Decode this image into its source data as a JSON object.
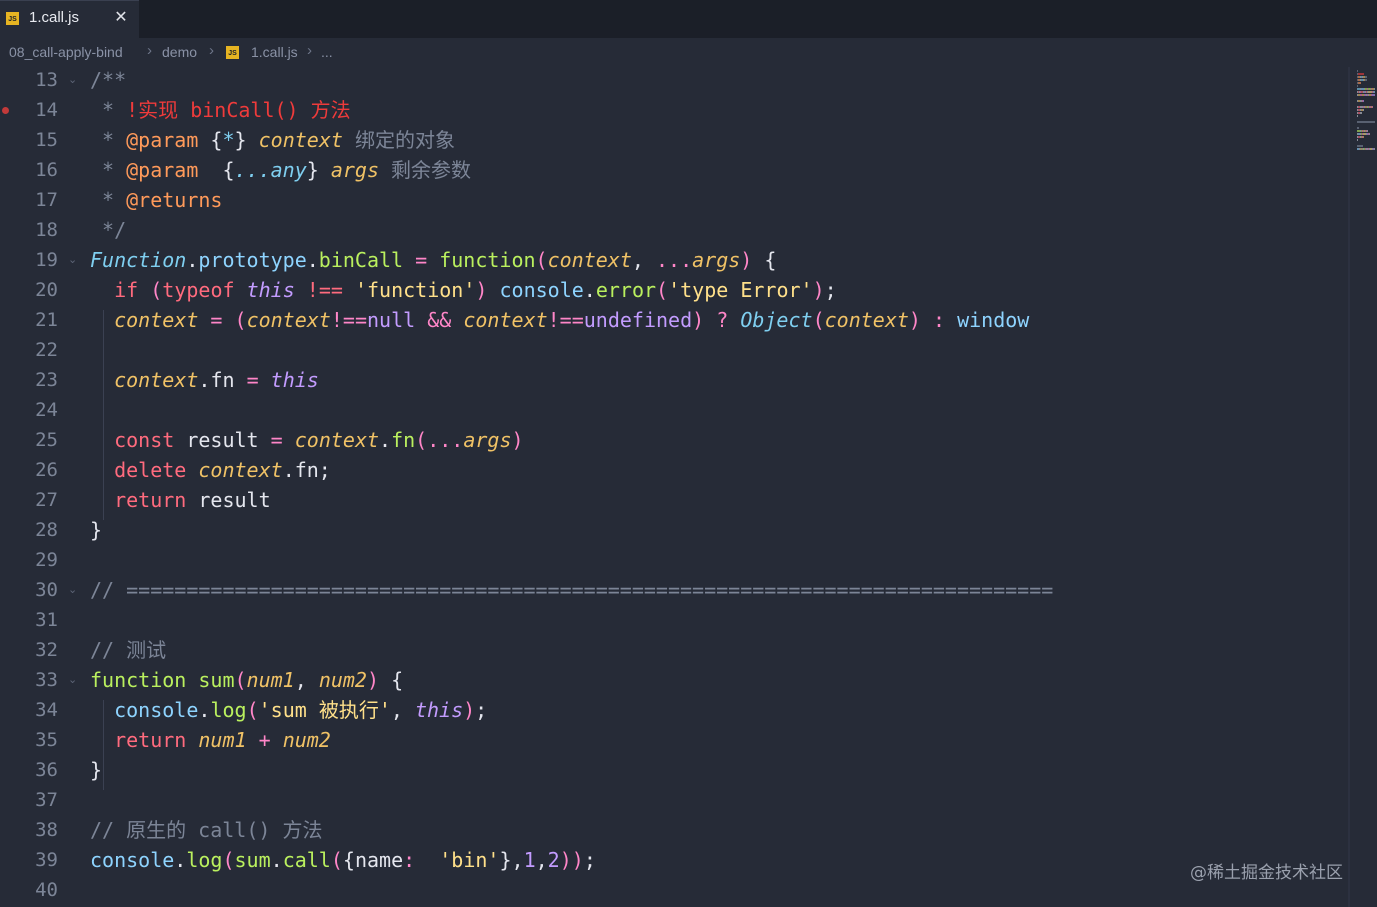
{
  "tab": {
    "icon": "js-file-icon",
    "badge": "JS",
    "title": "1.call.js",
    "close": "✕"
  },
  "breadcrumb": {
    "items": [
      "08_call-apply-bind",
      "demo",
      "1.call.js",
      "..."
    ],
    "separator": "›"
  },
  "editor": {
    "line_numbers": [
      "13",
      "14",
      "15",
      "16",
      "17",
      "18",
      "19",
      "20",
      "21",
      "22",
      "23",
      "24",
      "25",
      "26",
      "27",
      "28",
      "29",
      "30",
      "31",
      "32",
      "33",
      "34",
      "35",
      "36",
      "37",
      "38",
      "39",
      "40"
    ],
    "lines": [
      [
        [
          "cm",
          "/**"
        ]
      ],
      [
        [
          "cm",
          " * "
        ],
        [
          "red",
          "!实现 binCall() 方法"
        ]
      ],
      [
        [
          "cm",
          " * "
        ],
        [
          "tag",
          "@param"
        ],
        [
          "plain",
          " {"
        ],
        [
          "cls",
          "*"
        ],
        [
          "plain",
          "} "
        ],
        [
          "it",
          "context"
        ],
        [
          "cm",
          " 绑定的对象"
        ]
      ],
      [
        [
          "cm",
          " * "
        ],
        [
          "tag",
          "@param"
        ],
        [
          "plain",
          "  {"
        ],
        [
          "cls",
          "...any"
        ],
        [
          "plain",
          "} "
        ],
        [
          "it",
          "args"
        ],
        [
          "cm",
          " 剩余参数"
        ]
      ],
      [
        [
          "cm",
          " * "
        ],
        [
          "tag",
          "@returns"
        ]
      ],
      [
        [
          "cm",
          " */"
        ]
      ],
      [
        [
          "tealit",
          "Function"
        ],
        [
          "plain",
          "."
        ],
        [
          "prop",
          "prototype"
        ],
        [
          "plain",
          "."
        ],
        [
          "fn",
          "binCall"
        ],
        [
          "pink",
          " = "
        ],
        [
          "fn",
          "function"
        ],
        [
          "pl",
          "("
        ],
        [
          "it",
          "context"
        ],
        [
          "plain",
          ", "
        ],
        [
          "pink",
          "..."
        ],
        [
          "it",
          "args"
        ],
        [
          "pl",
          ")"
        ],
        [
          "plain",
          " {"
        ]
      ],
      [
        [
          "plain",
          "  "
        ],
        [
          "kw",
          "if"
        ],
        [
          "plain",
          " "
        ],
        [
          "pl",
          "("
        ],
        [
          "kw",
          "typeof"
        ],
        [
          "plain",
          " "
        ],
        [
          "purit",
          "this"
        ],
        [
          "plain",
          " "
        ],
        [
          "kw",
          "!=="
        ],
        [
          "plain",
          " "
        ],
        [
          "str",
          "'function'"
        ],
        [
          "pl",
          ")"
        ],
        [
          "plain",
          " "
        ],
        [
          "prop",
          "console"
        ],
        [
          "plain",
          "."
        ],
        [
          "fn",
          "error"
        ],
        [
          "pl",
          "("
        ],
        [
          "str",
          "'type Error'"
        ],
        [
          "pl",
          ")"
        ],
        [
          "plain",
          ";"
        ]
      ],
      [
        [
          "plain",
          "  "
        ],
        [
          "it",
          "context"
        ],
        [
          "pink",
          " = "
        ],
        [
          "pl",
          "("
        ],
        [
          "it",
          "context"
        ],
        [
          "pink",
          "!=="
        ],
        [
          "pur",
          "null"
        ],
        [
          "plain",
          " "
        ],
        [
          "pink",
          "&&"
        ],
        [
          "plain",
          " "
        ],
        [
          "it",
          "context"
        ],
        [
          "pink",
          "!=="
        ],
        [
          "pur",
          "undefined"
        ],
        [
          "pl",
          ")"
        ],
        [
          "pink",
          " ? "
        ],
        [
          "tealit",
          "Object"
        ],
        [
          "pl",
          "("
        ],
        [
          "it",
          "context"
        ],
        [
          "pl",
          ")"
        ],
        [
          "pink",
          " : "
        ],
        [
          "prop",
          "window"
        ]
      ],
      [],
      [
        [
          "plain",
          "  "
        ],
        [
          "it",
          "context"
        ],
        [
          "plain",
          "."
        ],
        [
          "plain",
          "fn"
        ],
        [
          "pink",
          " = "
        ],
        [
          "purit",
          "this"
        ]
      ],
      [],
      [
        [
          "plain",
          "  "
        ],
        [
          "kw",
          "const"
        ],
        [
          "plain",
          " result "
        ],
        [
          "pink",
          "="
        ],
        [
          "plain",
          " "
        ],
        [
          "it",
          "context"
        ],
        [
          "plain",
          "."
        ],
        [
          "fn",
          "fn"
        ],
        [
          "pl",
          "("
        ],
        [
          "pink",
          "..."
        ],
        [
          "it",
          "args"
        ],
        [
          "pl",
          ")"
        ]
      ],
      [
        [
          "plain",
          "  "
        ],
        [
          "kw",
          "delete"
        ],
        [
          "plain",
          " "
        ],
        [
          "it",
          "context"
        ],
        [
          "plain",
          ".fn;"
        ]
      ],
      [
        [
          "plain",
          "  "
        ],
        [
          "kw",
          "return"
        ],
        [
          "plain",
          " result"
        ]
      ],
      [
        [
          "plain",
          "}"
        ]
      ],
      [],
      [
        [
          "cm",
          "// ============================================================================="
        ]
      ],
      [],
      [
        [
          "cm",
          "// 测试"
        ]
      ],
      [
        [
          "fn",
          "function"
        ],
        [
          "plain",
          " "
        ],
        [
          "fn",
          "sum"
        ],
        [
          "pl",
          "("
        ],
        [
          "it",
          "num1"
        ],
        [
          "plain",
          ", "
        ],
        [
          "it",
          "num2"
        ],
        [
          "pl",
          ")"
        ],
        [
          "plain",
          " {"
        ]
      ],
      [
        [
          "plain",
          "  "
        ],
        [
          "prop",
          "console"
        ],
        [
          "plain",
          "."
        ],
        [
          "fn",
          "log"
        ],
        [
          "pl",
          "("
        ],
        [
          "str",
          "'sum 被执行'"
        ],
        [
          "plain",
          ", "
        ],
        [
          "purit",
          "this"
        ],
        [
          "pl",
          ")"
        ],
        [
          "plain",
          ";"
        ]
      ],
      [
        [
          "plain",
          "  "
        ],
        [
          "kw",
          "return"
        ],
        [
          "plain",
          " "
        ],
        [
          "it",
          "num1"
        ],
        [
          "pink",
          " + "
        ],
        [
          "it",
          "num2"
        ]
      ],
      [
        [
          "plain",
          "}"
        ]
      ],
      [],
      [
        [
          "cm",
          "// 原生的 call() 方法"
        ]
      ],
      [
        [
          "prop",
          "console"
        ],
        [
          "plain",
          "."
        ],
        [
          "fn",
          "log"
        ],
        [
          "pl",
          "("
        ],
        [
          "fn",
          "sum"
        ],
        [
          "plain",
          "."
        ],
        [
          "fn",
          "call"
        ],
        [
          "pl",
          "("
        ],
        [
          "plain",
          "{name"
        ],
        [
          "pink",
          ":"
        ],
        [
          "plain",
          "  "
        ],
        [
          "str",
          "'bin'"
        ],
        [
          "plain",
          "},"
        ],
        [
          "pur",
          "1"
        ],
        [
          "plain",
          ","
        ],
        [
          "pur",
          "2"
        ],
        [
          "pl",
          "))"
        ],
        [
          "plain",
          ";"
        ]
      ],
      []
    ],
    "fold_lines": [
      0,
      6,
      17,
      20
    ],
    "breakpoint_line": 1
  },
  "watermark": "@稀土掘金技术社区",
  "colors": {
    "background": "#262b37",
    "tabbar": "#1b1f28",
    "js_badge": "#e6b422",
    "comment": "#7c8597",
    "keyword": "#ff6b7e",
    "function": "#baf05e",
    "string": "#ffe08a",
    "parameter": "#f0c266"
  }
}
